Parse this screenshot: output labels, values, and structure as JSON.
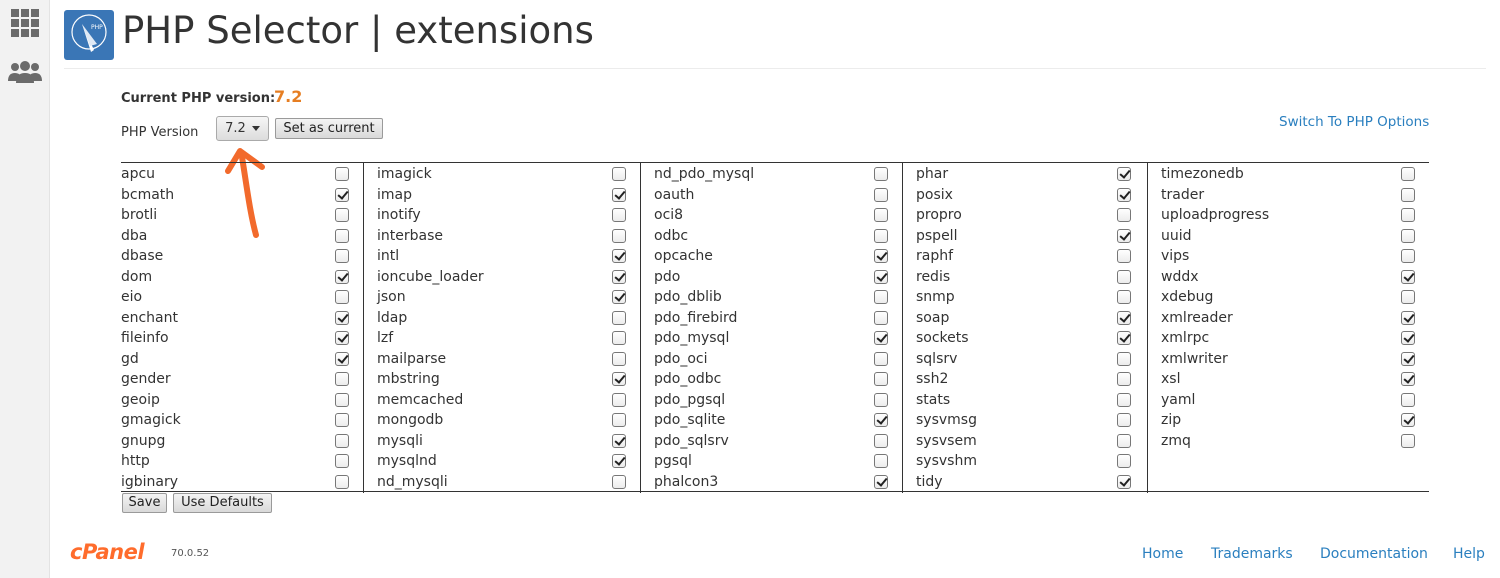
{
  "header": {
    "title": "PHP Selector | extensions"
  },
  "version": {
    "current_label": "Current PHP version:",
    "current_value": "7.2",
    "select_label": "PHP Version",
    "selected": "7.2",
    "set_current_label": "Set as current",
    "switch_link": "Switch To PHP Options"
  },
  "columns": [
    [
      {
        "name": "apcu",
        "checked": false
      },
      {
        "name": "bcmath",
        "checked": true
      },
      {
        "name": "brotli",
        "checked": false
      },
      {
        "name": "dba",
        "checked": false
      },
      {
        "name": "dbase",
        "checked": false
      },
      {
        "name": "dom",
        "checked": true
      },
      {
        "name": "eio",
        "checked": false
      },
      {
        "name": "enchant",
        "checked": true
      },
      {
        "name": "fileinfo",
        "checked": true
      },
      {
        "name": "gd",
        "checked": true
      },
      {
        "name": "gender",
        "checked": false
      },
      {
        "name": "geoip",
        "checked": false
      },
      {
        "name": "gmagick",
        "checked": false
      },
      {
        "name": "gnupg",
        "checked": false
      },
      {
        "name": "http",
        "checked": false
      },
      {
        "name": "igbinary",
        "checked": false
      }
    ],
    [
      {
        "name": "imagick",
        "checked": false
      },
      {
        "name": "imap",
        "checked": true
      },
      {
        "name": "inotify",
        "checked": false
      },
      {
        "name": "interbase",
        "checked": false
      },
      {
        "name": "intl",
        "checked": true
      },
      {
        "name": "ioncube_loader",
        "checked": true
      },
      {
        "name": "json",
        "checked": true
      },
      {
        "name": "ldap",
        "checked": false
      },
      {
        "name": "lzf",
        "checked": false
      },
      {
        "name": "mailparse",
        "checked": false
      },
      {
        "name": "mbstring",
        "checked": true
      },
      {
        "name": "memcached",
        "checked": false
      },
      {
        "name": "mongodb",
        "checked": false
      },
      {
        "name": "mysqli",
        "checked": true
      },
      {
        "name": "mysqlnd",
        "checked": true
      },
      {
        "name": "nd_mysqli",
        "checked": false
      }
    ],
    [
      {
        "name": "nd_pdo_mysql",
        "checked": false
      },
      {
        "name": "oauth",
        "checked": false
      },
      {
        "name": "oci8",
        "checked": false
      },
      {
        "name": "odbc",
        "checked": false
      },
      {
        "name": "opcache",
        "checked": true
      },
      {
        "name": "pdo",
        "checked": true
      },
      {
        "name": "pdo_dblib",
        "checked": false
      },
      {
        "name": "pdo_firebird",
        "checked": false
      },
      {
        "name": "pdo_mysql",
        "checked": true
      },
      {
        "name": "pdo_oci",
        "checked": false
      },
      {
        "name": "pdo_odbc",
        "checked": false
      },
      {
        "name": "pdo_pgsql",
        "checked": false
      },
      {
        "name": "pdo_sqlite",
        "checked": true
      },
      {
        "name": "pdo_sqlsrv",
        "checked": false
      },
      {
        "name": "pgsql",
        "checked": false
      },
      {
        "name": "phalcon3",
        "checked": true
      }
    ],
    [
      {
        "name": "phar",
        "checked": true
      },
      {
        "name": "posix",
        "checked": true
      },
      {
        "name": "propro",
        "checked": false
      },
      {
        "name": "pspell",
        "checked": true
      },
      {
        "name": "raphf",
        "checked": false
      },
      {
        "name": "redis",
        "checked": false
      },
      {
        "name": "snmp",
        "checked": false
      },
      {
        "name": "soap",
        "checked": true
      },
      {
        "name": "sockets",
        "checked": true
      },
      {
        "name": "sqlsrv",
        "checked": false
      },
      {
        "name": "ssh2",
        "checked": false
      },
      {
        "name": "stats",
        "checked": false
      },
      {
        "name": "sysvmsg",
        "checked": false
      },
      {
        "name": "sysvsem",
        "checked": false
      },
      {
        "name": "sysvshm",
        "checked": false
      },
      {
        "name": "tidy",
        "checked": true
      }
    ],
    [
      {
        "name": "timezonedb",
        "checked": false
      },
      {
        "name": "trader",
        "checked": false
      },
      {
        "name": "uploadprogress",
        "checked": false
      },
      {
        "name": "uuid",
        "checked": false
      },
      {
        "name": "vips",
        "checked": false
      },
      {
        "name": "wddx",
        "checked": true
      },
      {
        "name": "xdebug",
        "checked": false
      },
      {
        "name": "xmlreader",
        "checked": true
      },
      {
        "name": "xmlrpc",
        "checked": true
      },
      {
        "name": "xmlwriter",
        "checked": true
      },
      {
        "name": "xsl",
        "checked": true
      },
      {
        "name": "yaml",
        "checked": false
      },
      {
        "name": "zip",
        "checked": true
      },
      {
        "name": "zmq",
        "checked": false
      }
    ]
  ],
  "actions": {
    "save_label": "Save",
    "defaults_label": "Use Defaults"
  },
  "footer": {
    "brand": "cPanel",
    "version": "70.0.52",
    "links": [
      "Home",
      "Trademarks",
      "Documentation",
      "Help"
    ]
  },
  "colors": {
    "accent": "#e67e22",
    "link": "#2a7fbf",
    "arrow": "#f26a2c"
  },
  "icons": [
    "grid-icon",
    "users-icon",
    "php-selector-logo-icon",
    "caret-down-icon",
    "arrow-annotation-icon"
  ]
}
